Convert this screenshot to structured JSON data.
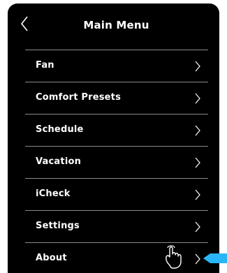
{
  "header": {
    "title": "Main Menu",
    "back_icon": "chevron-left-icon"
  },
  "menu": {
    "items": [
      {
        "label": "Fan",
        "icon": "chevron-right-icon"
      },
      {
        "label": "Comfort Presets",
        "icon": "chevron-right-icon"
      },
      {
        "label": "Schedule",
        "icon": "chevron-right-icon"
      },
      {
        "label": "Vacation",
        "icon": "chevron-right-icon"
      },
      {
        "label": "iCheck",
        "icon": "chevron-right-icon"
      },
      {
        "label": "Settings",
        "icon": "chevron-right-icon"
      },
      {
        "label": "About",
        "icon": "chevron-right-icon"
      }
    ]
  },
  "overlay": {
    "hand_icon": "tap-hand-icon",
    "pointer_icon": "pointer-arrow-icon"
  },
  "colors": {
    "background": "#000000",
    "text": "#ffffff",
    "divider": "#8a8a8a",
    "pointer": "#29b6f6"
  }
}
